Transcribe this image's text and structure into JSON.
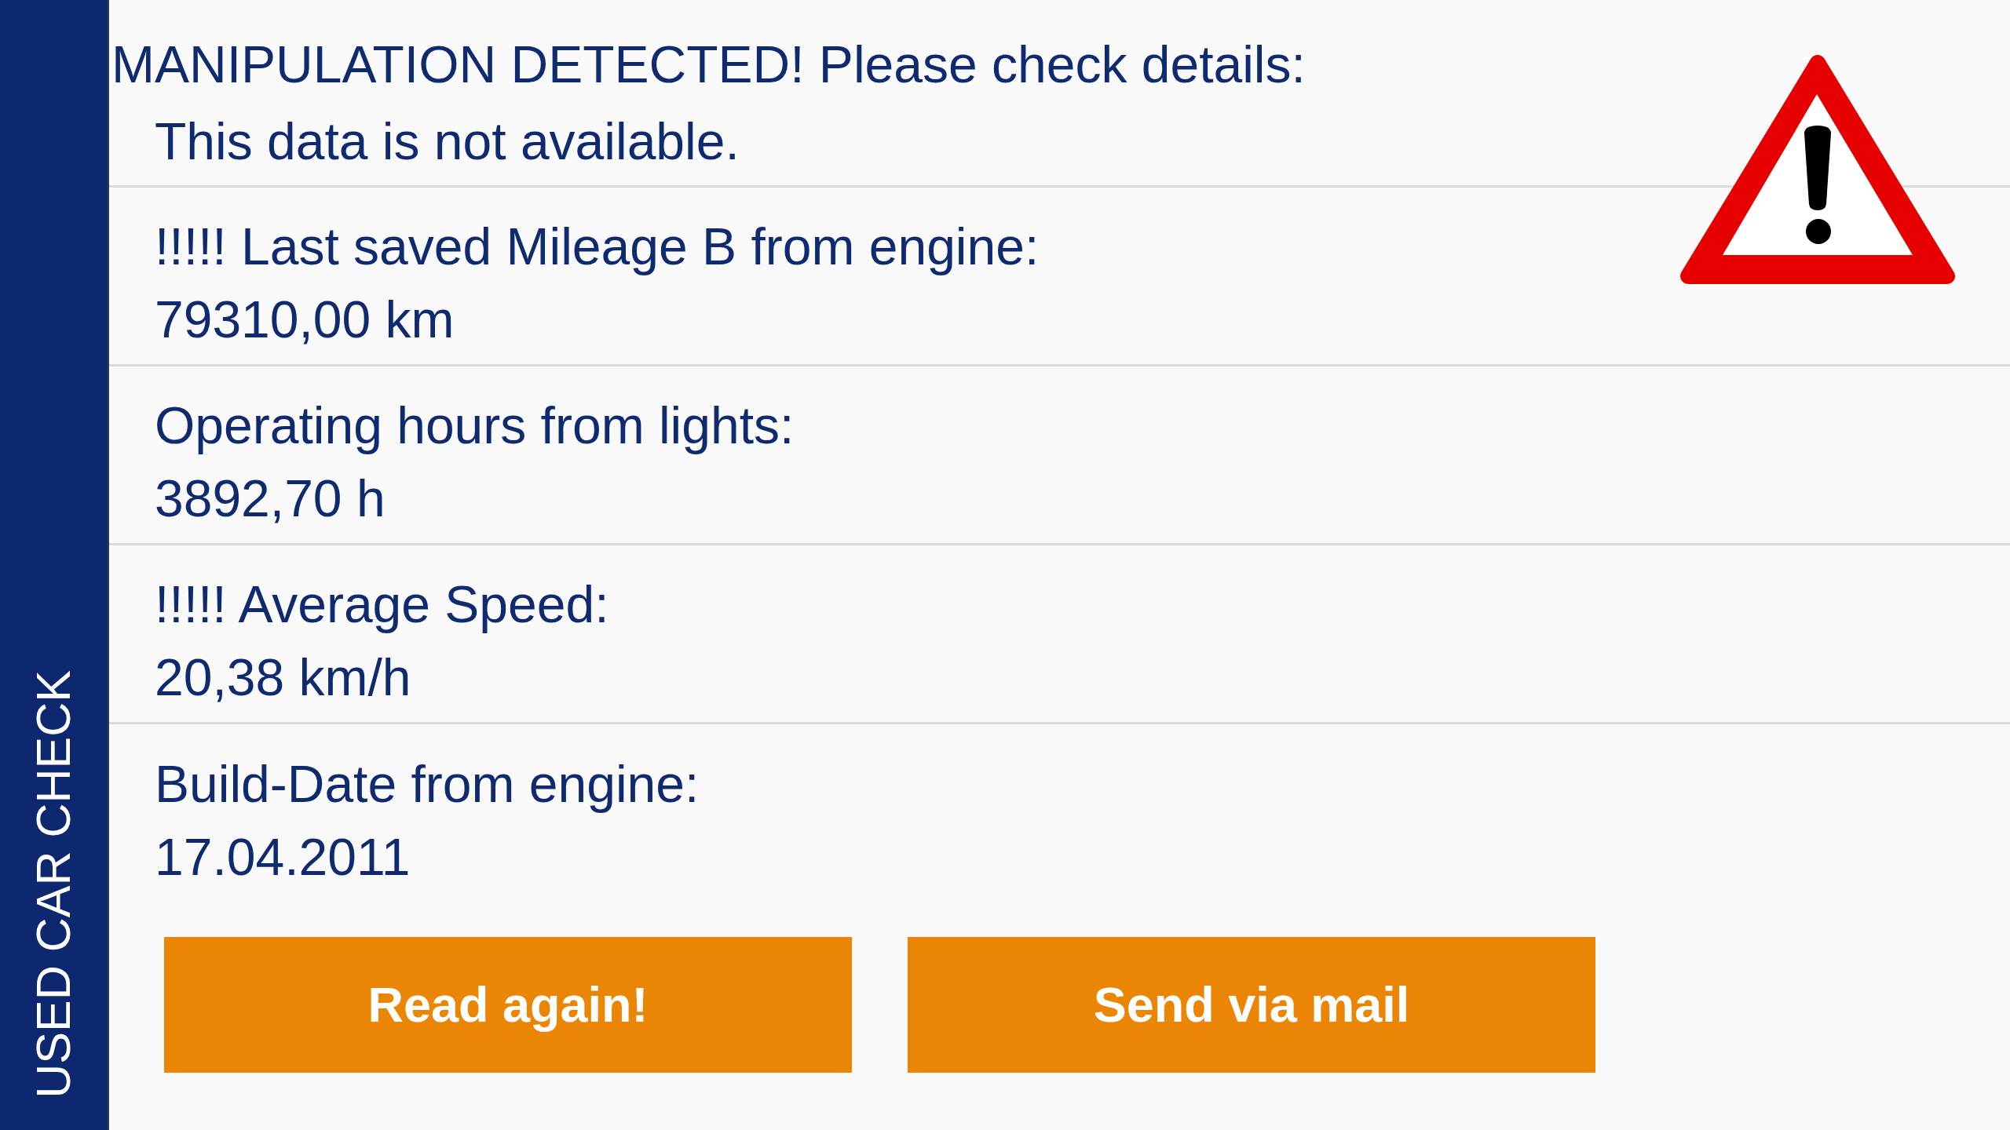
{
  "sidebar": {
    "title": "USED CAR CHECK"
  },
  "alert": {
    "title": "MANIPULATION DETECTED! Please check details:",
    "message": "This data is not available."
  },
  "details": [
    {
      "label": "!!!!! Last saved Mileage B from engine:",
      "value": "79310,00 km"
    },
    {
      "label": "Operating hours from lights:",
      "value": "3892,70 h"
    },
    {
      "label": "!!!!! Average Speed:",
      "value": "20,38 km/h"
    },
    {
      "label": "Build-Date from engine:",
      "value": "17.04.2011"
    }
  ],
  "buttons": [
    {
      "label": "Read again!"
    },
    {
      "label": "Send via mail"
    }
  ]
}
